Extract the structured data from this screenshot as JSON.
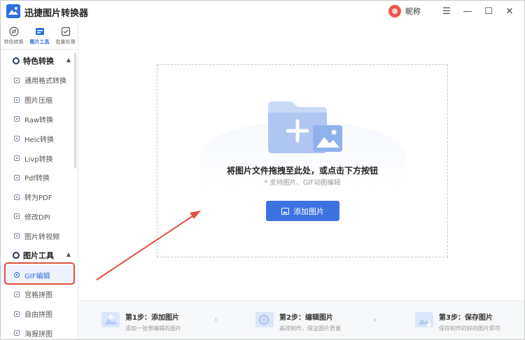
{
  "app": {
    "title": "迅捷图片转换器",
    "nickname": "昵称"
  },
  "window_controls": {
    "menu": "☰",
    "minimize": "—",
    "maximize": "☐",
    "close": "✕"
  },
  "topnav": [
    {
      "label": "特色转换",
      "icon": "convert-icon"
    },
    {
      "label": "图片工具",
      "icon": "toolbox-icon",
      "active": true
    },
    {
      "label": "批量处理",
      "icon": "batch-icon"
    }
  ],
  "sidebar": {
    "sections": [
      {
        "label": "特色转换",
        "items": [
          "通用格式转换",
          "图片压缩",
          "Raw转换",
          "Heic转换",
          "Livp转换",
          "Pdf转换",
          "转为PDF",
          "修改DPI",
          "图片转视频"
        ]
      },
      {
        "label": "图片工具",
        "items": [
          "GIF编辑",
          "宫格拼图",
          "自由拼图",
          "海报拼图"
        ],
        "selected": "GIF编辑"
      }
    ]
  },
  "dropzone": {
    "title": "将图片文件拖拽至此处，或点击下方按钮",
    "subtitle": "* 支持图片、GIF动图编辑",
    "button_label": "添加图片"
  },
  "steps": [
    {
      "title": "第1步：添加图片",
      "desc": "添加一张想编辑的图片"
    },
    {
      "title": "第2步：编辑图片",
      "desc": "高效制作，保证图片质量"
    },
    {
      "title": "第3步：保存图片",
      "desc": "保存制作的好的图片即可"
    }
  ],
  "colors": {
    "accent": "#3c73e0",
    "annotation": "#e05040"
  }
}
